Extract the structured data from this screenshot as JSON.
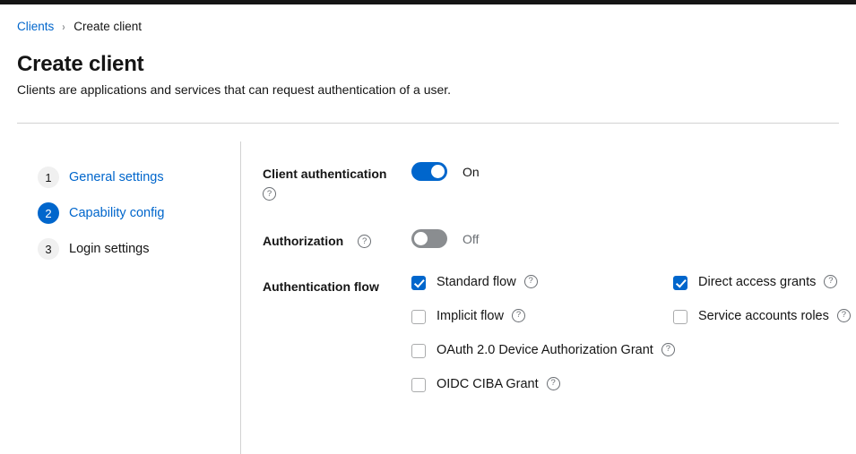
{
  "masthead": {
    "color": "#151515"
  },
  "breadcrumb": {
    "parent": "Clients",
    "separator": "›",
    "current": "Create client"
  },
  "header": {
    "title": "Create client",
    "subtitle": "Clients are applications and services that can request authentication of a user."
  },
  "wizard": {
    "steps": [
      {
        "num": "1",
        "label": "General settings",
        "state": "link"
      },
      {
        "num": "2",
        "label": "Capability config",
        "state": "current"
      },
      {
        "num": "3",
        "label": "Login settings",
        "state": "upcoming"
      }
    ]
  },
  "form": {
    "help_icon_glyph": "?",
    "help_icon_name": "help-icon",
    "client_authentication": {
      "label": "Client authentication",
      "state": "On",
      "checked": true
    },
    "authorization": {
      "label": "Authorization",
      "state": "Off",
      "checked": false
    },
    "authentication_flow": {
      "label": "Authentication flow",
      "options": [
        {
          "label": "Standard flow",
          "checked": true
        },
        {
          "label": "Direct access grants",
          "checked": true
        },
        {
          "label": "Implicit flow",
          "checked": false
        },
        {
          "label": "Service accounts roles",
          "checked": false
        },
        {
          "label": "OAuth 2.0 Device Authorization Grant",
          "checked": false
        },
        {
          "label": "OIDC CIBA Grant",
          "checked": false
        }
      ]
    }
  },
  "colors": {
    "accent": "#0066cc",
    "text": "#151515",
    "muted": "#6a6e73",
    "border": "#d2d2d2",
    "toggle_off": "#8a8d90",
    "step_inactive_bg": "#f0f0f0"
  }
}
